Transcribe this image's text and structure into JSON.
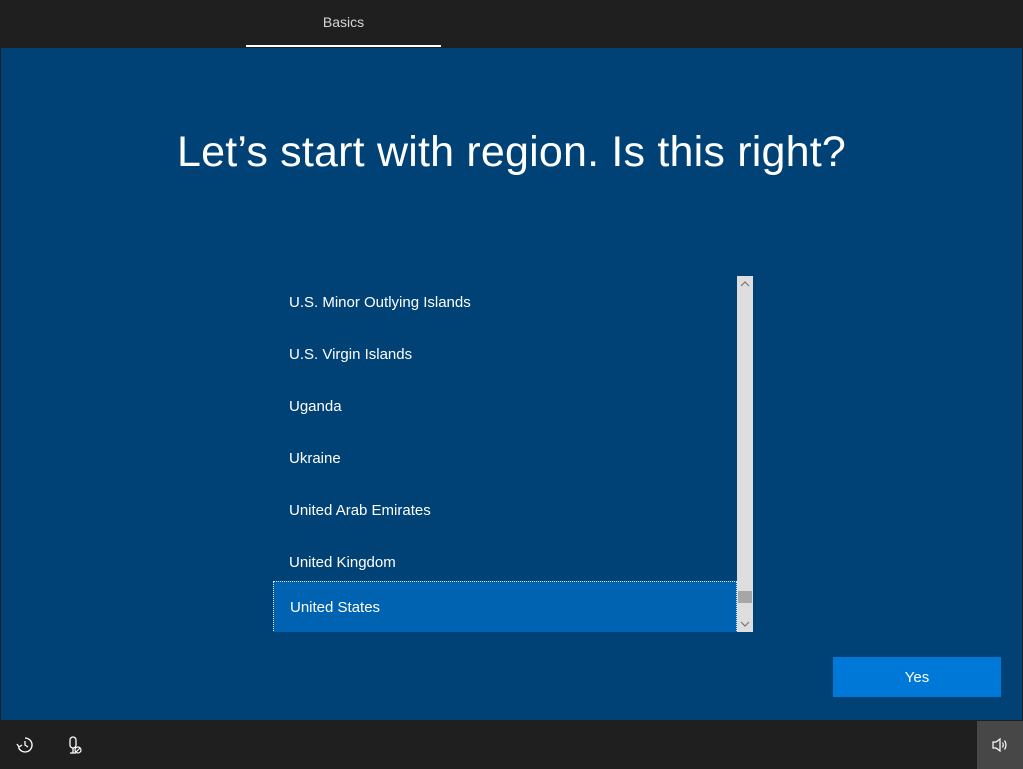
{
  "header": {
    "tab_label": "Basics"
  },
  "main": {
    "title": "Let’s start with region. Is this right?",
    "regions": [
      "U.S. Minor Outlying Islands",
      "U.S. Virgin Islands",
      "Uganda",
      "Ukraine",
      "United Arab Emirates",
      "United Kingdom",
      "United States"
    ],
    "selected_region": "United States",
    "yes_label": "Yes"
  },
  "bottombar": {
    "icons": [
      "ease-of-access-icon",
      "mic-off-icon",
      "volume-icon"
    ]
  },
  "colors": {
    "background": "#004275",
    "selected": "#0063b1",
    "button": "#0078d7",
    "bar": "#1f1f1f"
  }
}
